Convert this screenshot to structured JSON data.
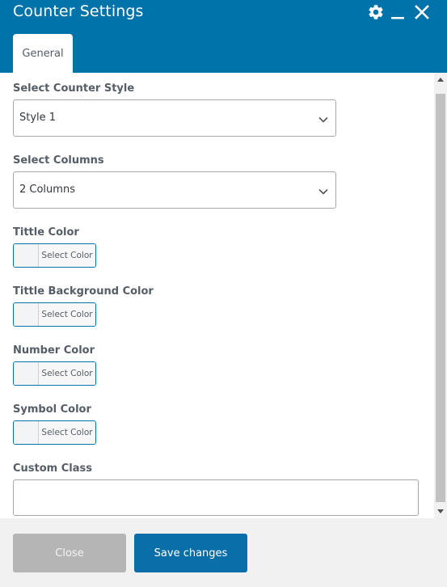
{
  "header": {
    "title": "Counter Settings",
    "icons": [
      "gear-icon",
      "minimize-icon",
      "close-icon"
    ],
    "color": "#0073aa"
  },
  "tabs": [
    {
      "label": "General",
      "active": true
    }
  ],
  "form": {
    "counter_style": {
      "label": "Select Counter Style",
      "value": "Style 1"
    },
    "columns": {
      "label": "Select Columns",
      "value": "2 Columns"
    },
    "title_color": {
      "label": "Tittle Color",
      "button": "Select Color"
    },
    "title_bg_color": {
      "label": "Tittle Background Color",
      "button": "Select Color"
    },
    "number_color": {
      "label": "Number Color",
      "button": "Select Color"
    },
    "symbol_color": {
      "label": "Symbol Color",
      "button": "Select Color"
    },
    "custom_class": {
      "label": "Custom Class",
      "value": ""
    }
  },
  "footer": {
    "close_label": "Close",
    "save_label": "Save changes"
  }
}
